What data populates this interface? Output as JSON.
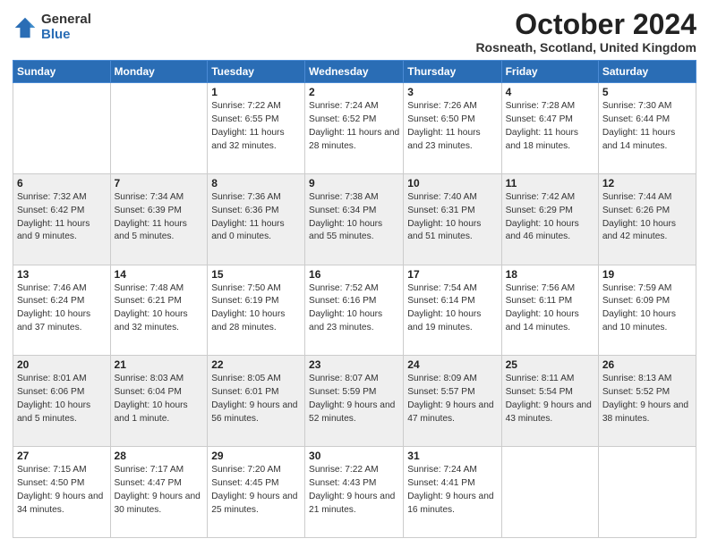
{
  "logo": {
    "general": "General",
    "blue": "Blue"
  },
  "header": {
    "month": "October 2024",
    "location": "Rosneath, Scotland, United Kingdom"
  },
  "weekdays": [
    "Sunday",
    "Monday",
    "Tuesday",
    "Wednesday",
    "Thursday",
    "Friday",
    "Saturday"
  ],
  "weeks": [
    [
      {
        "day": "",
        "info": ""
      },
      {
        "day": "",
        "info": ""
      },
      {
        "day": "1",
        "info": "Sunrise: 7:22 AM\nSunset: 6:55 PM\nDaylight: 11 hours and 32 minutes."
      },
      {
        "day": "2",
        "info": "Sunrise: 7:24 AM\nSunset: 6:52 PM\nDaylight: 11 hours and 28 minutes."
      },
      {
        "day": "3",
        "info": "Sunrise: 7:26 AM\nSunset: 6:50 PM\nDaylight: 11 hours and 23 minutes."
      },
      {
        "day": "4",
        "info": "Sunrise: 7:28 AM\nSunset: 6:47 PM\nDaylight: 11 hours and 18 minutes."
      },
      {
        "day": "5",
        "info": "Sunrise: 7:30 AM\nSunset: 6:44 PM\nDaylight: 11 hours and 14 minutes."
      }
    ],
    [
      {
        "day": "6",
        "info": "Sunrise: 7:32 AM\nSunset: 6:42 PM\nDaylight: 11 hours and 9 minutes."
      },
      {
        "day": "7",
        "info": "Sunrise: 7:34 AM\nSunset: 6:39 PM\nDaylight: 11 hours and 5 minutes."
      },
      {
        "day": "8",
        "info": "Sunrise: 7:36 AM\nSunset: 6:36 PM\nDaylight: 11 hours and 0 minutes."
      },
      {
        "day": "9",
        "info": "Sunrise: 7:38 AM\nSunset: 6:34 PM\nDaylight: 10 hours and 55 minutes."
      },
      {
        "day": "10",
        "info": "Sunrise: 7:40 AM\nSunset: 6:31 PM\nDaylight: 10 hours and 51 minutes."
      },
      {
        "day": "11",
        "info": "Sunrise: 7:42 AM\nSunset: 6:29 PM\nDaylight: 10 hours and 46 minutes."
      },
      {
        "day": "12",
        "info": "Sunrise: 7:44 AM\nSunset: 6:26 PM\nDaylight: 10 hours and 42 minutes."
      }
    ],
    [
      {
        "day": "13",
        "info": "Sunrise: 7:46 AM\nSunset: 6:24 PM\nDaylight: 10 hours and 37 minutes."
      },
      {
        "day": "14",
        "info": "Sunrise: 7:48 AM\nSunset: 6:21 PM\nDaylight: 10 hours and 32 minutes."
      },
      {
        "day": "15",
        "info": "Sunrise: 7:50 AM\nSunset: 6:19 PM\nDaylight: 10 hours and 28 minutes."
      },
      {
        "day": "16",
        "info": "Sunrise: 7:52 AM\nSunset: 6:16 PM\nDaylight: 10 hours and 23 minutes."
      },
      {
        "day": "17",
        "info": "Sunrise: 7:54 AM\nSunset: 6:14 PM\nDaylight: 10 hours and 19 minutes."
      },
      {
        "day": "18",
        "info": "Sunrise: 7:56 AM\nSunset: 6:11 PM\nDaylight: 10 hours and 14 minutes."
      },
      {
        "day": "19",
        "info": "Sunrise: 7:59 AM\nSunset: 6:09 PM\nDaylight: 10 hours and 10 minutes."
      }
    ],
    [
      {
        "day": "20",
        "info": "Sunrise: 8:01 AM\nSunset: 6:06 PM\nDaylight: 10 hours and 5 minutes."
      },
      {
        "day": "21",
        "info": "Sunrise: 8:03 AM\nSunset: 6:04 PM\nDaylight: 10 hours and 1 minute."
      },
      {
        "day": "22",
        "info": "Sunrise: 8:05 AM\nSunset: 6:01 PM\nDaylight: 9 hours and 56 minutes."
      },
      {
        "day": "23",
        "info": "Sunrise: 8:07 AM\nSunset: 5:59 PM\nDaylight: 9 hours and 52 minutes."
      },
      {
        "day": "24",
        "info": "Sunrise: 8:09 AM\nSunset: 5:57 PM\nDaylight: 9 hours and 47 minutes."
      },
      {
        "day": "25",
        "info": "Sunrise: 8:11 AM\nSunset: 5:54 PM\nDaylight: 9 hours and 43 minutes."
      },
      {
        "day": "26",
        "info": "Sunrise: 8:13 AM\nSunset: 5:52 PM\nDaylight: 9 hours and 38 minutes."
      }
    ],
    [
      {
        "day": "27",
        "info": "Sunrise: 7:15 AM\nSunset: 4:50 PM\nDaylight: 9 hours and 34 minutes."
      },
      {
        "day": "28",
        "info": "Sunrise: 7:17 AM\nSunset: 4:47 PM\nDaylight: 9 hours and 30 minutes."
      },
      {
        "day": "29",
        "info": "Sunrise: 7:20 AM\nSunset: 4:45 PM\nDaylight: 9 hours and 25 minutes."
      },
      {
        "day": "30",
        "info": "Sunrise: 7:22 AM\nSunset: 4:43 PM\nDaylight: 9 hours and 21 minutes."
      },
      {
        "day": "31",
        "info": "Sunrise: 7:24 AM\nSunset: 4:41 PM\nDaylight: 9 hours and 16 minutes."
      },
      {
        "day": "",
        "info": ""
      },
      {
        "day": "",
        "info": ""
      }
    ]
  ]
}
